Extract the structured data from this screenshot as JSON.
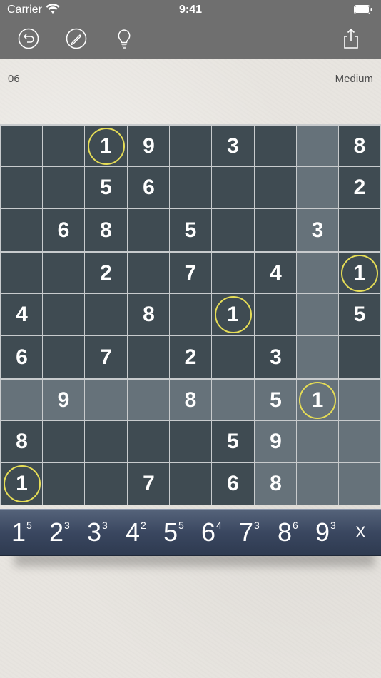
{
  "status_bar": {
    "carrier": "Carrier",
    "time": "9:41"
  },
  "toolbar": {
    "undo_icon": "undo-icon",
    "erase_icon": "pencil-slash-icon",
    "hint_icon": "lightbulb-icon",
    "share_icon": "share-icon"
  },
  "puzzle": {
    "number": "06",
    "difficulty": "Medium"
  },
  "board": {
    "rows": [
      [
        "",
        "",
        "1",
        "9",
        "",
        "3",
        "",
        "",
        "8"
      ],
      [
        "",
        "",
        "5",
        "6",
        "",
        "",
        "",
        "",
        "2"
      ],
      [
        "",
        "6",
        "8",
        "",
        "5",
        "",
        "",
        "3",
        ""
      ],
      [
        "",
        "",
        "2",
        "",
        "7",
        "",
        "4",
        "",
        "1"
      ],
      [
        "4",
        "",
        "",
        "8",
        "",
        "1",
        "",
        "",
        "5"
      ],
      [
        "6",
        "",
        "7",
        "",
        "2",
        "",
        "3",
        "",
        ""
      ],
      [
        "",
        "9",
        "",
        "",
        "8",
        "",
        "5",
        "1",
        ""
      ],
      [
        "8",
        "",
        "",
        "",
        "",
        "5",
        "9",
        "",
        ""
      ],
      [
        "1",
        "",
        "",
        "7",
        "",
        "6",
        "8",
        "",
        ""
      ]
    ],
    "highlighted_digit": "1",
    "highlighted_row": 6,
    "highlighted_col": 7,
    "colors": {
      "cell": "#3f4b52",
      "highlight": "#66727a",
      "ring": "#e6dd56"
    }
  },
  "number_tray": {
    "items": [
      {
        "digit": "1",
        "remaining": "5"
      },
      {
        "digit": "2",
        "remaining": "3"
      },
      {
        "digit": "3",
        "remaining": "3"
      },
      {
        "digit": "4",
        "remaining": "2"
      },
      {
        "digit": "5",
        "remaining": "5"
      },
      {
        "digit": "6",
        "remaining": "4"
      },
      {
        "digit": "7",
        "remaining": "3"
      },
      {
        "digit": "8",
        "remaining": "6"
      },
      {
        "digit": "9",
        "remaining": "3"
      }
    ],
    "clear_label": "X"
  }
}
